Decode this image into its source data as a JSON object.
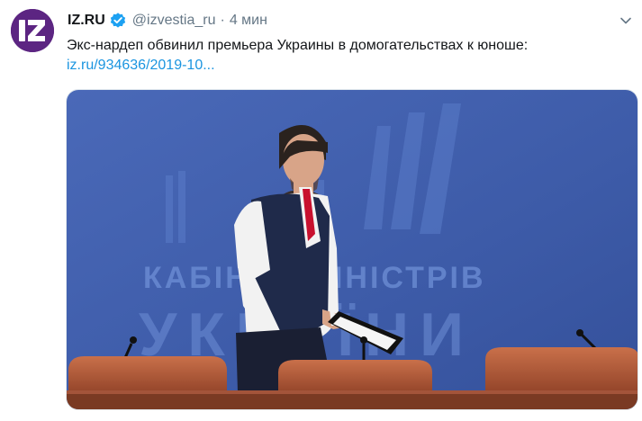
{
  "tweet": {
    "author_name": "IZ.RU",
    "verified": true,
    "handle": "@izvestia_ru",
    "separator": "·",
    "time": "4 мин",
    "text": "Экс-нардеп обвинил премьера Украины в домогательствах к юноше:",
    "link": "iz.ru/934636/2019-10...",
    "avatar_text": "iz"
  },
  "media": {
    "backdrop_line1": "КАБІНЕТ МІНІСТРІВ",
    "backdrop_line2": "УКРАЇНИ"
  },
  "colors": {
    "brand_purple": "#5c2582",
    "link_blue": "#1b95e0",
    "verified_blue": "#1da1f2",
    "backdrop_blue": "#3f5fae"
  },
  "icons": [
    "verified-badge-icon",
    "chevron-down-icon"
  ]
}
